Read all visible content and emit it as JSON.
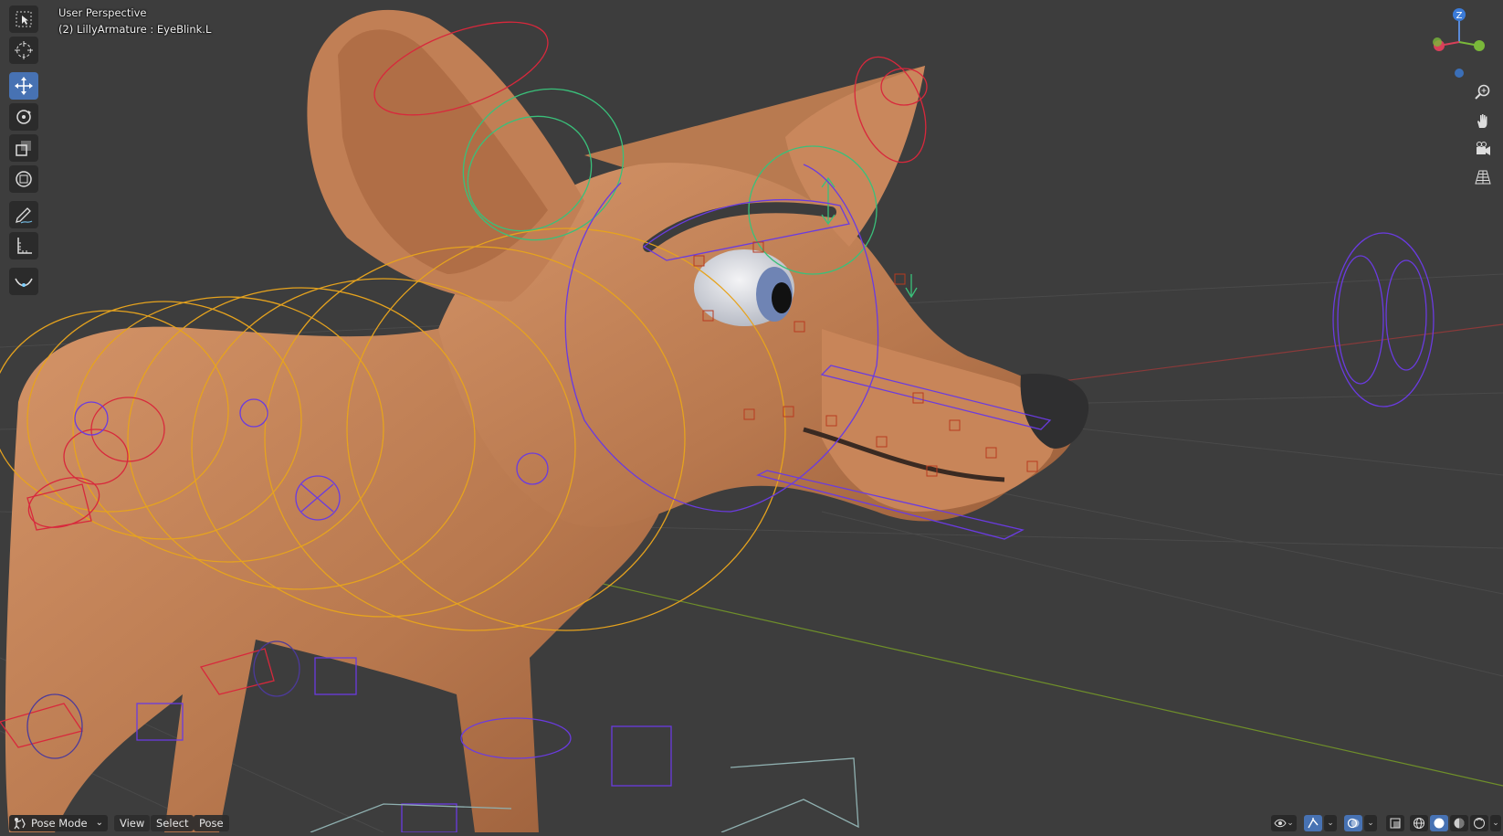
{
  "viewport": {
    "view_name": "User Perspective",
    "active_info": "(2) LillyArmature : EyeBlink.L"
  },
  "toolbar": {
    "tools": [
      {
        "name": "select-box-icon",
        "active": false
      },
      {
        "name": "cursor-icon",
        "active": false
      },
      {
        "name": "move-icon",
        "active": true
      },
      {
        "name": "rotate-icon",
        "active": false
      },
      {
        "name": "scale-icon",
        "active": false
      },
      {
        "name": "transform-icon",
        "active": false
      },
      {
        "name": "annotate-icon",
        "active": false
      },
      {
        "name": "measure-icon",
        "active": false
      },
      {
        "name": "relax-icon",
        "active": false
      }
    ]
  },
  "gizmo": {
    "axis_z": "Z"
  },
  "header": {
    "mode": "Pose Mode",
    "menus": [
      "View",
      "Select",
      "Pose"
    ]
  },
  "colors": {
    "background": "#3d3d3d",
    "accent": "#4772b3",
    "skin": "#c8845a",
    "bone_yellow": "#e6a31e",
    "bone_purple": "#6a3be0",
    "bone_red": "#d8283c",
    "bone_green": "#3ac07a"
  }
}
